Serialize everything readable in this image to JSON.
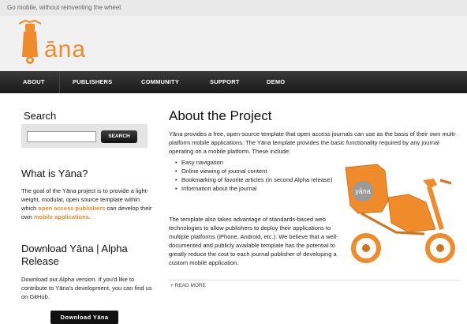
{
  "tagline": "Go mobile, without reinventing the wheel.",
  "logo": {
    "text": "āna",
    "brand_color": "#f08b2b"
  },
  "nav": [
    "ABOUT",
    "PUBLISHERS",
    "COMMUNITY",
    "SUPPORT",
    "DEMO"
  ],
  "sidebar": {
    "search_heading": "Search",
    "search_placeholder": "",
    "search_button": "SEARCH",
    "what_heading": "What is Yāna?",
    "what_text_1": "The goal of the Yāna project is to provide a light-weight, modular, open source template within which",
    "what_link_1": "open access publishers",
    "what_text_2": "can develop their own",
    "what_link_2": "mobile applications",
    "what_text_3": ".",
    "download_heading": "Download Yāna | Alpha Release",
    "download_text": "Download our Alpha version. If you'd like to contribute to Yāna's development, you can find us on GitHub.",
    "download_button": "Download Yāna"
  },
  "main": {
    "title": "About the Project",
    "intro": "Yāna provides a free, open-source template that open access journals can use as the basis of their own multi-platform mobile applications. The Yāna template provides the basic functionality required by any journal operating on a mobile platform. These include:",
    "bullets": [
      "Easy navigation",
      "Online viewing of journal content",
      "Bookmarking of favorite articles (in second Alpha release)",
      "Information about the journal"
    ],
    "para2": "The template also takes advantage of standards-based web technologies to allow publishers to deploy their applications to multiple platforms (iPhone, Android, etc.). We believe that a well-documented and publicly available template has the potential to greatly reduce the cost to each journal publisher of developing a custom mobile application.",
    "read_more": "+ READ MORE",
    "scooter_badge": "yāna"
  }
}
